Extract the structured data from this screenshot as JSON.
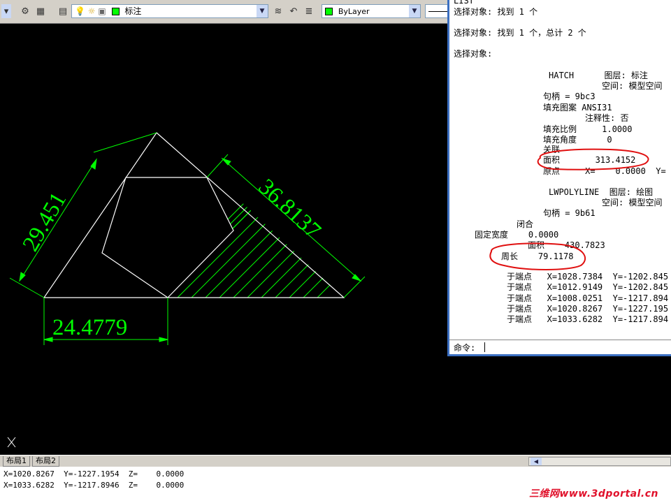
{
  "toolbar": {
    "layer_combo_value": "标注",
    "color_combo_value": "ByLayer",
    "layer_color": "#00ff00"
  },
  "drawing": {
    "dim_left": "29.451",
    "dim_right": "36.8137",
    "dim_bottom": "24.4779",
    "dim_color": "#00ff00"
  },
  "text_window": {
    "lines": [
      "LIST",
      "选择对象: 找到 1 个",
      "选择对象: 找到 1 个，总计 2 个",
      "选择对象:",
      "HATCH      图层: 标注",
      "空间: 模型空间",
      "句柄 = 9bc3",
      "填充图案 ANSI31",
      "注释性: 否",
      "填充比例     1.0000",
      "填充角度      0",
      "关联",
      "面积       313.4152",
      "原点     X=    0.0000  Y=",
      "LWPOLYLINE  图层: 绘图",
      "空间: 模型空间",
      "句柄 = 9b61",
      "闭合",
      "固定宽度    0.0000",
      "面积    430.7823",
      "周长    79.1178",
      "于端点   X=1028.7384  Y=-1202.845",
      "于端点   X=1012.9149  Y=-1202.845",
      "于端点   X=1008.0251  Y=-1217.894",
      "于端点   X=1020.8267  Y=-1227.195",
      "于端点   X=1033.6282  Y=-1217.894"
    ],
    "prompt": "命令:"
  },
  "tabs": [
    "布局1",
    "布局2"
  ],
  "command_history": [
    "X=1020.8267  Y=-1227.1954  Z=    0.0000",
    "X=1033.6282  Y=-1217.8946  Z=    0.0000"
  ],
  "watermark": "三维网www.3dportal.cn"
}
